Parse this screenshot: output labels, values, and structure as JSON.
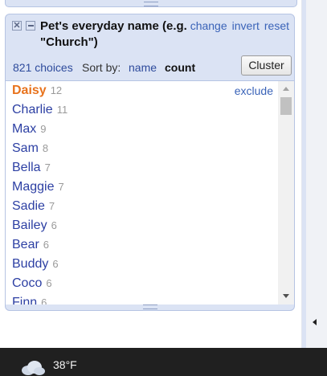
{
  "facet": {
    "title": "Pet's everyday name (e.g. \"Church\")",
    "links": {
      "change": "change",
      "invert": "invert",
      "reset": "reset"
    },
    "choices_count": "821 choices",
    "sort_label": "Sort by:",
    "sort_name": "name",
    "sort_count": "count",
    "cluster_button": "Cluster",
    "exclude_label": "exclude",
    "items": [
      {
        "label": "Daisy",
        "count": "12",
        "selected": true
      },
      {
        "label": "Charlie",
        "count": "11"
      },
      {
        "label": "Max",
        "count": "9"
      },
      {
        "label": "Sam",
        "count": "8"
      },
      {
        "label": "Bella",
        "count": "7"
      },
      {
        "label": "Maggie",
        "count": "7"
      },
      {
        "label": "Sadie",
        "count": "7"
      },
      {
        "label": "Bailey",
        "count": "6"
      },
      {
        "label": "Bear",
        "count": "6"
      },
      {
        "label": "Buddy",
        "count": "6"
      },
      {
        "label": "Coco",
        "count": "6"
      },
      {
        "label": "Finn",
        "count": "6"
      }
    ]
  },
  "taskbar": {
    "weather_icon": "cloud-icon",
    "temperature": "38°F"
  }
}
